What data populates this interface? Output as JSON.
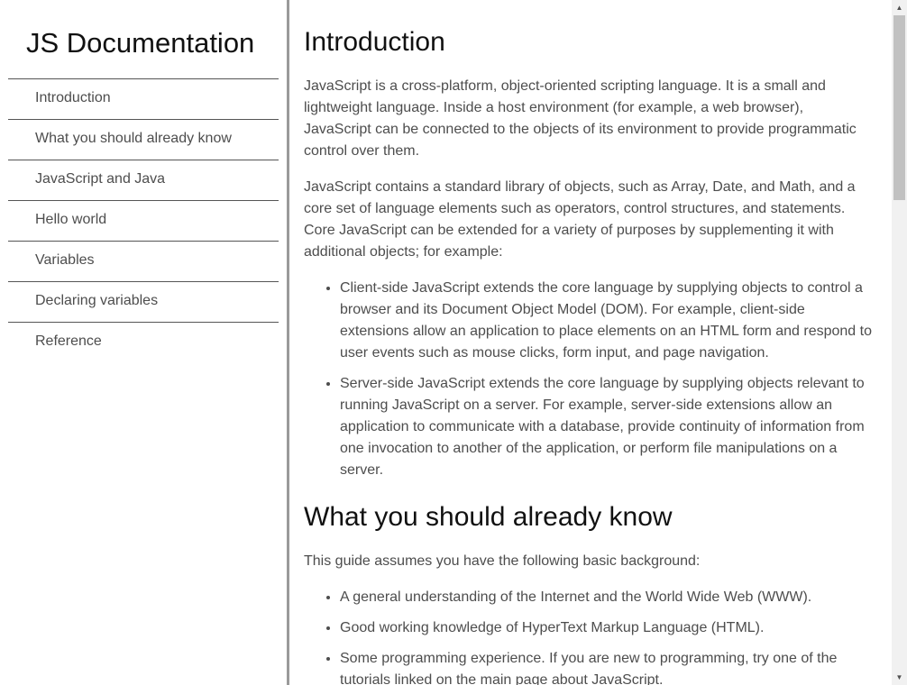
{
  "sidebar": {
    "title": "JS Documentation",
    "items": [
      {
        "label": "Introduction"
      },
      {
        "label": "What you should already know"
      },
      {
        "label": "JavaScript and Java"
      },
      {
        "label": "Hello world"
      },
      {
        "label": "Variables"
      },
      {
        "label": "Declaring variables"
      },
      {
        "label": "Reference"
      }
    ]
  },
  "main": {
    "sections": [
      {
        "title": "Introduction",
        "paragraphs": [
          "JavaScript is a cross-platform, object-oriented scripting language. It is a small and lightweight language. Inside a host environment (for example, a web browser), JavaScript can be connected to the objects of its environment to provide programmatic control over them.",
          "JavaScript contains a standard library of objects, such as Array, Date, and Math, and a core set of language elements such as operators, control structures, and statements. Core JavaScript can be extended for a variety of purposes by supplementing it with additional objects; for example:"
        ],
        "bullets": [
          "Client-side JavaScript extends the core language by supplying objects to control a browser and its Document Object Model (DOM). For example, client-side extensions allow an application to place elements on an HTML form and respond to user events such as mouse clicks, form input, and page navigation.",
          "Server-side JavaScript extends the core language by supplying objects relevant to running JavaScript on a server. For example, server-side extensions allow an application to communicate with a database, provide continuity of information from one invocation to another of the application, or perform file manipulations on a server."
        ]
      },
      {
        "title": "What you should already know",
        "paragraphs": [
          "This guide assumes you have the following basic background:"
        ],
        "bullets": [
          "A general understanding of the Internet and the World Wide Web (WWW).",
          "Good working knowledge of HyperText Markup Language (HTML).",
          "Some programming experience. If you are new to programming, try one of the tutorials linked on the main page about JavaScript."
        ]
      }
    ]
  },
  "scrollbar": {
    "up_icon": "triangle-up",
    "down_icon": "triangle-down",
    "up_glyph": "▲",
    "down_glyph": "▼"
  }
}
